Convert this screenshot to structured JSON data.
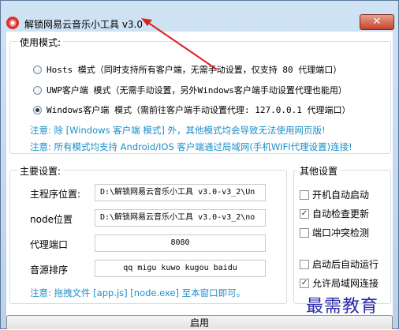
{
  "window": {
    "title": "解锁网易云音乐小工具 v3.0",
    "close_glyph": "✕",
    "app_icon_glyph": "◉"
  },
  "mode_group": {
    "label": "使用模式:",
    "options": [
      {
        "label": "Hosts 模式（同时支持所有客户端，无需手动设置，仅支持 80 代理端口）",
        "checked": false
      },
      {
        "label": "UWP客户端 模式（无需手动设置，另外Windows客户端手动设置代理也能用）",
        "checked": false
      },
      {
        "label": "Windows客户端 模式（需前往客户端手动设置代理: 127.0.0.1 代理端口）",
        "checked": true
      }
    ],
    "note1": "注意: 除 [Windows 客户端 模式] 外，其他模式均会导致无法使用网页版!",
    "note2": "注意: 所有模式均支持 Android/IOS 客户端通过局域网(手机WIFI代理设置)连接!"
  },
  "main_group": {
    "label": "主要设置:",
    "fields": [
      {
        "label": "主程序位置:",
        "value": "D:\\解锁网易云音乐小工具 v3.0-v3_2\\Un"
      },
      {
        "label": "node位置",
        "value": "D:\\解锁网易云音乐小工具 v3.0-v3_2\\no"
      },
      {
        "label": "代理端口",
        "value": "8080"
      },
      {
        "label": "音源排序",
        "value": "qq migu kuwo kugou baidu"
      }
    ],
    "note": "注意: 拖拽文件 [app.js] [node.exe] 至本窗口即可。"
  },
  "other_group": {
    "label": "其他设置",
    "items": [
      {
        "label": "开机自动启动",
        "checked": false
      },
      {
        "label": "自动检查更新",
        "checked": true
      },
      {
        "label": "端口冲突检测",
        "checked": false
      },
      {
        "label": "启动后自动运行",
        "checked": false
      },
      {
        "label": "允许局域网连接",
        "checked": true
      }
    ]
  },
  "start_button": {
    "label": "启用"
  },
  "watermark": "最需教育",
  "colors": {
    "note_blue": "#1b8fc8",
    "arrow_red": "#e0201c",
    "watermark_blue": "#2a2aa8"
  },
  "icons": {
    "check": "✓"
  }
}
